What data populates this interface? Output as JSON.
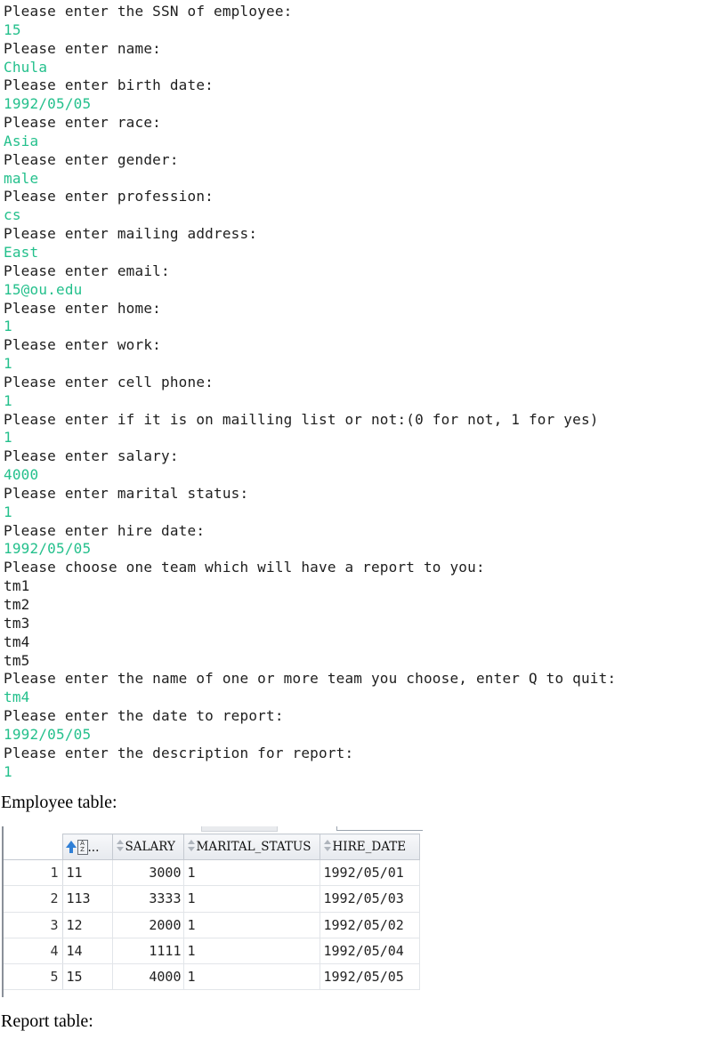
{
  "console": {
    "lines": [
      {
        "t": "Please enter the SSN of employee:",
        "k": "prompt"
      },
      {
        "t": "15",
        "k": "input"
      },
      {
        "t": "Please enter name:",
        "k": "prompt"
      },
      {
        "t": "Chula",
        "k": "input"
      },
      {
        "t": "Please enter birth date:",
        "k": "prompt"
      },
      {
        "t": "1992/05/05",
        "k": "input"
      },
      {
        "t": "Please enter race:",
        "k": "prompt"
      },
      {
        "t": "Asia",
        "k": "input"
      },
      {
        "t": "Please enter gender:",
        "k": "prompt"
      },
      {
        "t": "male",
        "k": "input"
      },
      {
        "t": "Please enter profession:",
        "k": "prompt"
      },
      {
        "t": "cs",
        "k": "input"
      },
      {
        "t": "Please enter mailing address:",
        "k": "prompt"
      },
      {
        "t": "East",
        "k": "input"
      },
      {
        "t": "Please enter email:",
        "k": "prompt"
      },
      {
        "t": "15@ou.edu",
        "k": "input"
      },
      {
        "t": "Please enter home:",
        "k": "prompt"
      },
      {
        "t": "1",
        "k": "input"
      },
      {
        "t": "Please enter work:",
        "k": "prompt"
      },
      {
        "t": "1",
        "k": "input"
      },
      {
        "t": "Please enter cell phone:",
        "k": "prompt"
      },
      {
        "t": "1",
        "k": "input"
      },
      {
        "t": "Please enter if it is on mailling list or not:(0 for not, 1 for yes)",
        "k": "prompt"
      },
      {
        "t": "1",
        "k": "input"
      },
      {
        "t": "Please enter salary:",
        "k": "prompt"
      },
      {
        "t": "4000",
        "k": "input"
      },
      {
        "t": "Please enter marital status:",
        "k": "prompt"
      },
      {
        "t": "1",
        "k": "input"
      },
      {
        "t": "Please enter hire date:",
        "k": "prompt"
      },
      {
        "t": "1992/05/05",
        "k": "input"
      },
      {
        "t": "Please choose one team which will have a report to you:",
        "k": "prompt"
      },
      {
        "t": "tm1",
        "k": "prompt"
      },
      {
        "t": "tm2",
        "k": "prompt"
      },
      {
        "t": "tm3",
        "k": "prompt"
      },
      {
        "t": "tm4",
        "k": "prompt"
      },
      {
        "t": "tm5",
        "k": "prompt"
      },
      {
        "t": "Please enter the name of one or more team you choose, enter Q to quit:",
        "k": "prompt"
      },
      {
        "t": "tm4",
        "k": "input"
      },
      {
        "t": "Please enter the date to report:",
        "k": "prompt"
      },
      {
        "t": "1992/05/05",
        "k": "input"
      },
      {
        "t": "Please enter the description for report:",
        "k": "prompt"
      },
      {
        "t": "1",
        "k": "input"
      }
    ]
  },
  "captions": {
    "employee": "Employee table:",
    "report": "Report table:"
  },
  "grid": {
    "first_header_ellipsis": "...",
    "columns": [
      "SALARY",
      "MARITAL_STATUS",
      "HIRE_DATE"
    ],
    "rows": [
      {
        "n": "1",
        "ssn": "11",
        "salary": "3000",
        "marital": "1",
        "hire": "1992/05/01"
      },
      {
        "n": "2",
        "ssn": "113",
        "salary": "3333",
        "marital": "1",
        "hire": "1992/05/03"
      },
      {
        "n": "3",
        "ssn": "12",
        "salary": "2000",
        "marital": "1",
        "hire": "1992/05/02"
      },
      {
        "n": "4",
        "ssn": "14",
        "salary": "1111",
        "marital": "1",
        "hire": "1992/05/04"
      },
      {
        "n": "5",
        "ssn": "15",
        "salary": "4000",
        "marital": "1",
        "hire": "1992/05/05"
      }
    ]
  },
  "colors": {
    "prompt_text": "#1e1e1e",
    "input_text": "#24c08c",
    "sort_icon_accent": "#2f7fd6"
  },
  "icons": [
    "sort-ascending-az-icon",
    "sort-arrows-icon"
  ]
}
